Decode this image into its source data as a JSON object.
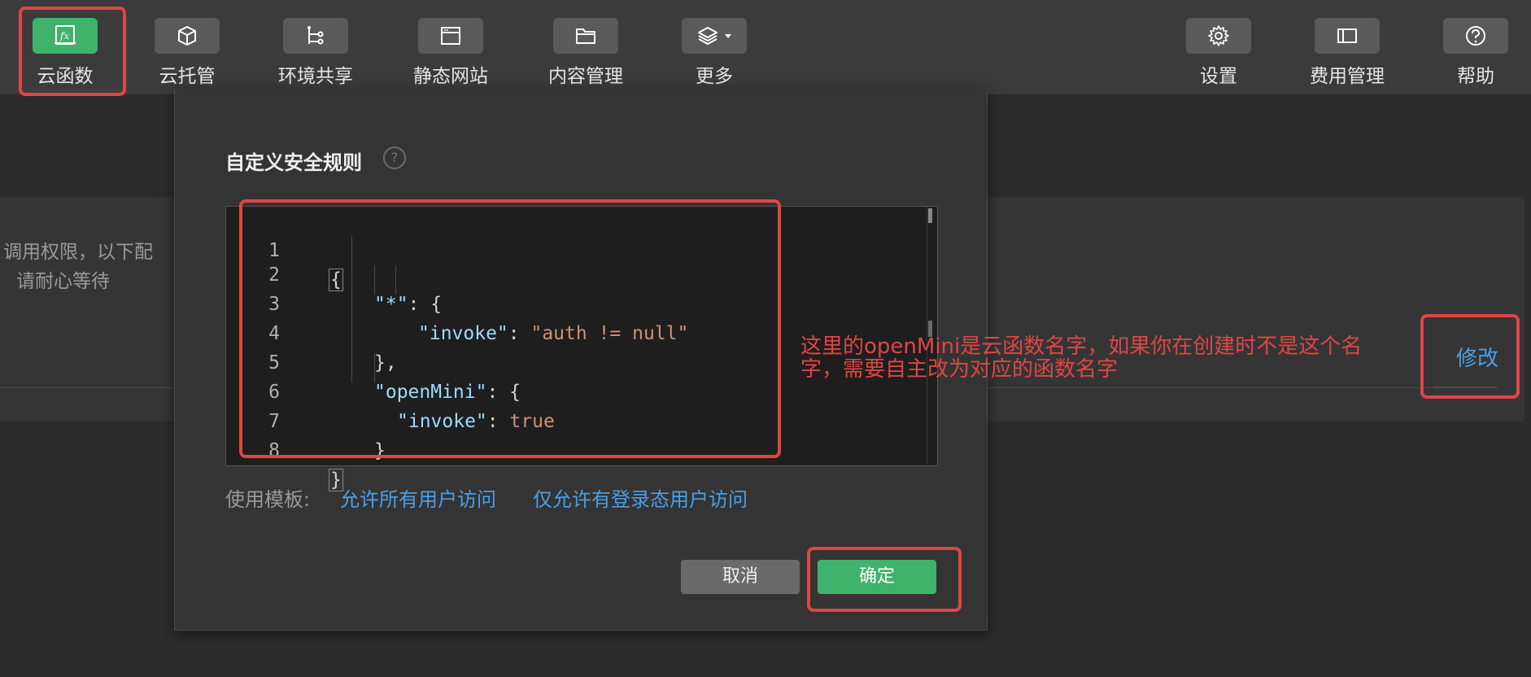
{
  "toolbar": {
    "items": [
      {
        "label": "云函数",
        "icon": "fx-icon",
        "active": true
      },
      {
        "label": "云托管",
        "icon": "cube-icon"
      },
      {
        "label": "环境共享",
        "icon": "branch-icon"
      },
      {
        "label": "静态网站",
        "icon": "browser-window-icon"
      },
      {
        "label": "内容管理",
        "icon": "folder-icon"
      },
      {
        "label": "更多",
        "icon": "layers-icon"
      },
      {
        "label": "设置",
        "icon": "gear-icon"
      },
      {
        "label": "费用管理",
        "icon": "ticket-icon"
      },
      {
        "label": "帮助",
        "icon": "question-circle-icon"
      }
    ],
    "fx_glyph": "fx"
  },
  "background": {
    "line1": "调用权限，以下配",
    "line2": "请耐心等待",
    "modify_link": "修改"
  },
  "modal": {
    "title": "自定义安全规则",
    "help_glyph": "?",
    "code_lines": [
      {
        "n": "1"
      },
      {
        "n": "2"
      },
      {
        "n": "3"
      },
      {
        "n": "4"
      },
      {
        "n": "5"
      },
      {
        "n": "6"
      },
      {
        "n": "7"
      },
      {
        "n": "8"
      }
    ],
    "code": {
      "star_key": "\"*\"",
      "invoke_key": "\"invoke\"",
      "invoke_value": "\"auth != null\"",
      "openmini_key": "\"openMini\"",
      "invoke_true": "true"
    },
    "template_label": "使用模板:",
    "template_links": [
      "允许所有用户访问",
      "仅允许有登录态用户访问"
    ],
    "cancel_label": "取消",
    "ok_label": "确定"
  },
  "annotation": {
    "text": "这里的openMini是云函数名字，如果你在创建时不是这个名字，需要自主改为对应的函数名字",
    "color": "#e04545"
  },
  "colors": {
    "accent_green": "#3fb26b",
    "link_blue": "#4a9fe8",
    "annotation_red": "#e04545"
  }
}
